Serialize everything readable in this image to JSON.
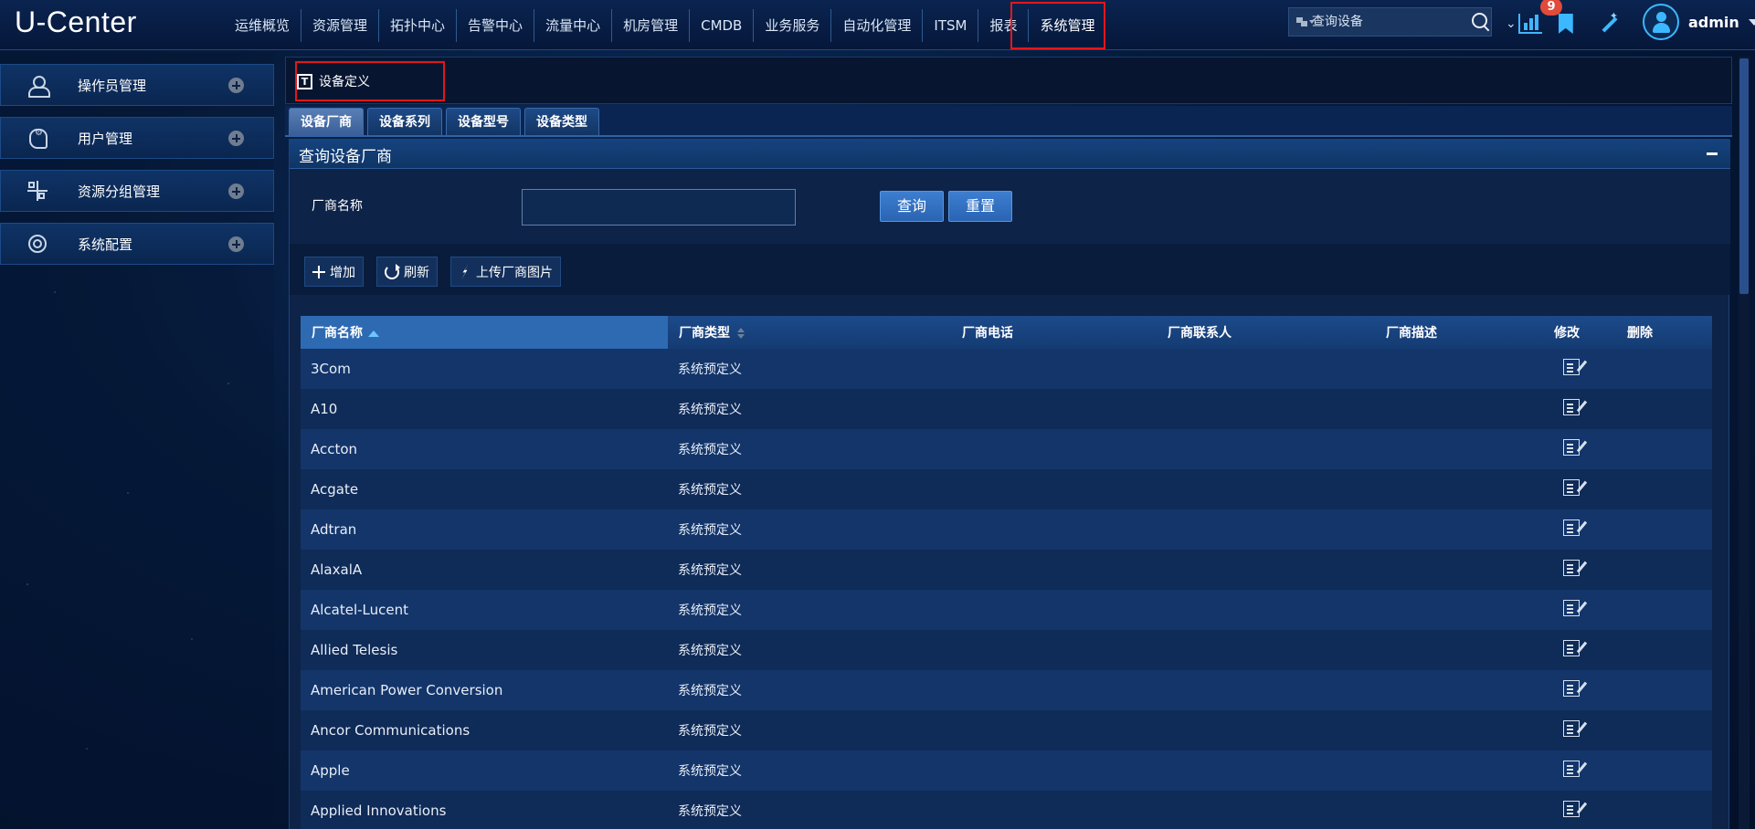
{
  "app": {
    "logo": "U-Center"
  },
  "nav": {
    "items": [
      {
        "label": "运维概览"
      },
      {
        "label": "资源管理"
      },
      {
        "label": "拓扑中心"
      },
      {
        "label": "告警中心"
      },
      {
        "label": "流量中心"
      },
      {
        "label": "机房管理"
      },
      {
        "label": "CMDB"
      },
      {
        "label": "业务服务"
      },
      {
        "label": "自动化管理"
      },
      {
        "label": "ITSM"
      },
      {
        "label": "报表"
      },
      {
        "label": "系统管理"
      }
    ],
    "active_index": 11
  },
  "search": {
    "placeholder": "查询设备"
  },
  "notifications": {
    "count": "9"
  },
  "user": {
    "name": "admin"
  },
  "sidebar": {
    "items": [
      {
        "label": "操作员管理",
        "icon": "operator-icon"
      },
      {
        "label": "用户管理",
        "icon": "user-settings-icon"
      },
      {
        "label": "资源分组管理",
        "icon": "resource-group-icon"
      },
      {
        "label": "系统配置",
        "icon": "system-config-icon"
      }
    ]
  },
  "page": {
    "title": "设备定义",
    "tabs": [
      {
        "label": "设备厂商",
        "active": true
      },
      {
        "label": "设备系列",
        "active": false
      },
      {
        "label": "设备型号",
        "active": false
      },
      {
        "label": "设备类型",
        "active": false
      }
    ],
    "panel_title": "查询设备厂商",
    "query": {
      "label": "厂商名称",
      "value": "",
      "search_label": "查询",
      "reset_label": "重置"
    },
    "toolbar": {
      "add_label": "增加",
      "refresh_label": "刷新",
      "upload_label": "上传厂商图片"
    },
    "table": {
      "columns": [
        "厂商名称",
        "厂商类型",
        "厂商电话",
        "厂商联系人",
        "厂商描述",
        "修改",
        "删除"
      ],
      "rows": [
        {
          "name": "3Com",
          "type": "系统预定义"
        },
        {
          "name": "A10",
          "type": "系统预定义"
        },
        {
          "name": "Accton",
          "type": "系统预定义"
        },
        {
          "name": "Acgate",
          "type": "系统预定义"
        },
        {
          "name": "Adtran",
          "type": "系统预定义"
        },
        {
          "name": "AlaxalA",
          "type": "系统预定义"
        },
        {
          "name": "Alcatel-Lucent",
          "type": "系统预定义"
        },
        {
          "name": "Allied Telesis",
          "type": "系统预定义"
        },
        {
          "name": "American Power Conversion",
          "type": "系统预定义"
        },
        {
          "name": "Ancor Communications",
          "type": "系统预定义"
        },
        {
          "name": "Apple",
          "type": "系统预定义"
        },
        {
          "name": "Applied Innovations",
          "type": "系统预定义"
        }
      ]
    }
  },
  "colors": {
    "accent": "#3bb8ff",
    "highlight_border": "#e0181c",
    "button_blue": "#2a64b2",
    "badge": "#e24a3b"
  }
}
